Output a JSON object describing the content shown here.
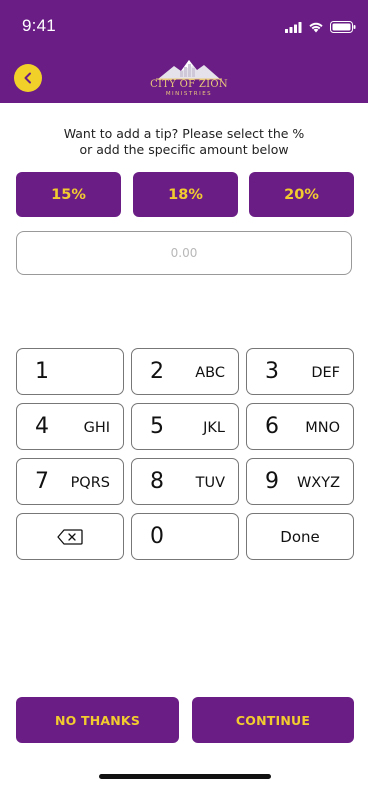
{
  "status_bar": {
    "time": "9:41"
  },
  "header": {
    "logo_text": "CITY OF ZION",
    "logo_subtext": "MINISTRIES",
    "colors": {
      "background": "#6b1d86",
      "accent": "#f1d02a"
    }
  },
  "prompt": {
    "line1": "Want to add a tip? Please select the %",
    "line2": "or add the specific amount below"
  },
  "tip_options": [
    {
      "label": "15%"
    },
    {
      "label": "18%"
    },
    {
      "label": "20%"
    }
  ],
  "amount_input": {
    "placeholder": "0.00",
    "value": ""
  },
  "keypad": {
    "rows": [
      [
        {
          "digit": "1",
          "letters": ""
        },
        {
          "digit": "2",
          "letters": "ABC"
        },
        {
          "digit": "3",
          "letters": "DEF"
        }
      ],
      [
        {
          "digit": "4",
          "letters": "GHI"
        },
        {
          "digit": "5",
          "letters": "JKL"
        },
        {
          "digit": "6",
          "letters": "MNO"
        }
      ],
      [
        {
          "digit": "7",
          "letters": "PQRS"
        },
        {
          "digit": "8",
          "letters": "TUV"
        },
        {
          "digit": "9",
          "letters": "WXYZ"
        }
      ]
    ],
    "delete_icon": "backspace-icon",
    "zero": "0",
    "done_label": "Done"
  },
  "actions": {
    "no_thanks_label": "NO THANKS",
    "continue_label": "CONTINUE"
  }
}
